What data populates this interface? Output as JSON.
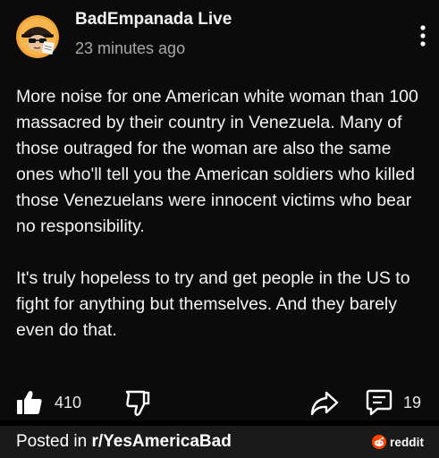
{
  "post": {
    "author": "BadEmpanada Live",
    "time": "23 minutes ago",
    "paragraphs": [
      "More noise for one American white woman than 100 massacred by their country in Venezuela. Many of those outraged for the woman are also the same ones who'll tell you the American soldiers who killed those Venezuelans were innocent victims who bear no responsibility.",
      "It's truly hopeless to try and get people in the US to fight for anything but themselves. And they barely even do that."
    ]
  },
  "actions": {
    "upvotes": "410",
    "comments": "19"
  },
  "footer": {
    "posted_prefix": "Posted in ",
    "subreddit": "r/YesAmericaBad",
    "brand": "reddit"
  },
  "icons": {
    "more": "vertical-dots-icon",
    "upvote": "thumbs-up-icon",
    "downvote": "thumbs-down-icon",
    "share": "share-arrow-icon",
    "comment": "comment-bubble-icon",
    "brand_logo": "reddit-snoo-icon"
  },
  "colors": {
    "background": "#0b0b0b",
    "footer_bar": "#1a1a1a",
    "text": "#f4f4f4",
    "muted": "#a8a8a8",
    "brand_orange": "#ff4500"
  }
}
